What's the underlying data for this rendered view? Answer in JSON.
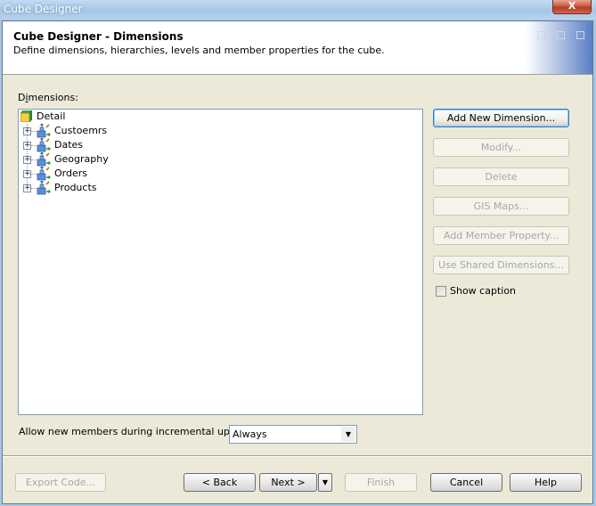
{
  "window": {
    "title": "Cube Designer",
    "close_label": "X"
  },
  "header": {
    "title": "Cube Designer - Dimensions",
    "subtitle": "Define dimensions, hierarchies, levels and member properties for the cube."
  },
  "dimensions": {
    "label": "Dimensions:",
    "root": {
      "label": "Detail",
      "icon": "cube-icon"
    },
    "items": [
      {
        "label": "Custoemrs",
        "icon": "dimension-icon",
        "expand": "+"
      },
      {
        "label": "Dates",
        "icon": "dimension-icon",
        "expand": "+"
      },
      {
        "label": "Geography",
        "icon": "dimension-icon",
        "expand": "+"
      },
      {
        "label": "Orders",
        "icon": "dimension-icon",
        "expand": "+"
      },
      {
        "label": "Products",
        "icon": "dimension-icon",
        "expand": "+"
      }
    ]
  },
  "actions": {
    "add_new_dimension": "Add New Dimension...",
    "modify": "Modify...",
    "delete": "Delete",
    "gis_maps": "GIS Maps...",
    "add_member_property": "Add Member Property...",
    "use_shared_dimensions": "Use Shared Dimensions...",
    "show_caption": "Show caption",
    "show_caption_checked": false
  },
  "incremental": {
    "label": "Allow new members during incremental update:",
    "selected": "Always"
  },
  "footer": {
    "export_code": "Export Code...",
    "back": "< Back",
    "next": "Next >",
    "finish": "Finish",
    "cancel": "Cancel",
    "help": "Help"
  }
}
